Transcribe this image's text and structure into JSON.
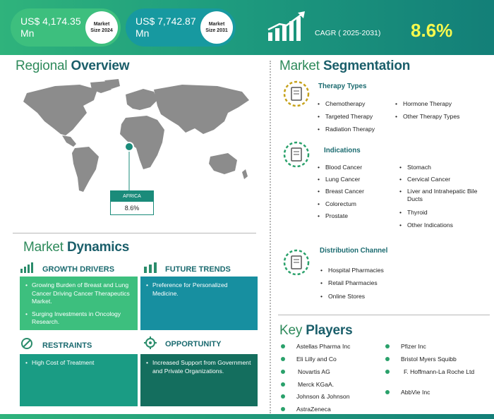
{
  "header": {
    "size2024_value": "US$ 4,174.35",
    "size2024_unit": "Mn",
    "size2024_label_1": "Market",
    "size2024_label_2": "Size 2024",
    "size2031_value": "US$ 7,742.87",
    "size2031_unit": "Mn",
    "size2031_label_1": "Market",
    "size2031_label_2": "Size 2031",
    "cagr_label": "CAGR ( 2025-2031)",
    "cagr_value": "8.6%"
  },
  "regional": {
    "title_light": "Regional ",
    "title_bold": "Overview",
    "region_name": "AFRICA",
    "region_value": "8.6%"
  },
  "dynamics": {
    "title_light": "Market ",
    "title_bold": "Dynamics",
    "growth_title": "GROWTH DRIVERS",
    "growth_items": [
      "Growing Burden of Breast and Lung Cancer Driving Cancer Therapeutics Market.",
      "Surging Investments in Oncology Research."
    ],
    "future_title": "FUTURE TRENDS",
    "future_items": [
      "Preference for Personalized Medicine."
    ],
    "restraints_title": "RESTRAINTS",
    "restraints_items": [
      "High Cost of Treatment"
    ],
    "opportunity_title": "OPPORTUNITY",
    "opportunity_items": [
      "Increased Support from Government and Private Organizations."
    ]
  },
  "segmentation": {
    "title_light": "Market ",
    "title_bold": "Segmentation",
    "therapy_title": "Therapy Types",
    "therapy_col1": [
      "Chemotherapy",
      "Targeted Therapy",
      "Radiation Therapy"
    ],
    "therapy_col2": [
      "Hormone Therapy",
      "Other Therapy Types"
    ],
    "indications_title": "Indications",
    "indications_col1": [
      "Blood Cancer",
      "Lung Cancer",
      "Breast Cancer",
      "Colorectum",
      "Prostate"
    ],
    "indications_col2": [
      "Stomach",
      "Cervical Cancer",
      "Liver and Intrahepatic Bile Ducts",
      "Thyroid",
      "Other Indications"
    ],
    "distribution_title": "Distribution Channel",
    "distribution_items": [
      "Hospital Pharmacies",
      "Retail Pharmacies",
      "Online Stores"
    ]
  },
  "players": {
    "title_light": "Key ",
    "title_bold": "Players",
    "col1": [
      "Astellas Pharma Inc",
      "Eli Lilly and Co",
      "Novartis AG",
      "Merck KGaA.",
      "Johnson & Johnson",
      "AstraZeneca"
    ],
    "col2": [
      "Pfizer Inc",
      "Bristol Myers Squibb",
      "F. Hoffmann-La Roche Ltd",
      "AbbVie Inc"
    ]
  },
  "colors": {
    "header_green": "#2fb37c",
    "header_teal": "#137f78",
    "cagr_yellow": "#f6f94d",
    "growth_box": "#3dbf7e",
    "future_box": "#178fa0",
    "restraints_box": "#1a9c84",
    "opportunity_box": "#146e5e"
  }
}
